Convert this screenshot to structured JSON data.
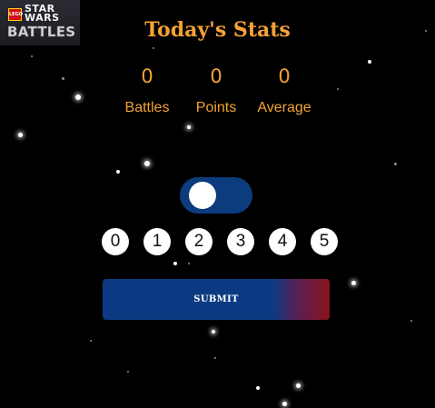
{
  "logo": {
    "lego_text": "LEGO",
    "star_wars_text": "STAR\nWARS",
    "battles_text": "BATTLES"
  },
  "title": "Today's Stats",
  "stats": [
    {
      "value": "0",
      "label": "Battles"
    },
    {
      "value": "0",
      "label": "Points"
    },
    {
      "value": "0",
      "label": "Average"
    }
  ],
  "toggle": {
    "state": "off"
  },
  "ratings": [
    "0",
    "1",
    "2",
    "3",
    "4",
    "5"
  ],
  "submit_label": "SUBMIT",
  "colors": {
    "background": "#000000",
    "accent": "#f5a235",
    "toggle_track": "#0c3b7e",
    "button_blue": "#0c3a82",
    "button_red": "#8a1418"
  }
}
